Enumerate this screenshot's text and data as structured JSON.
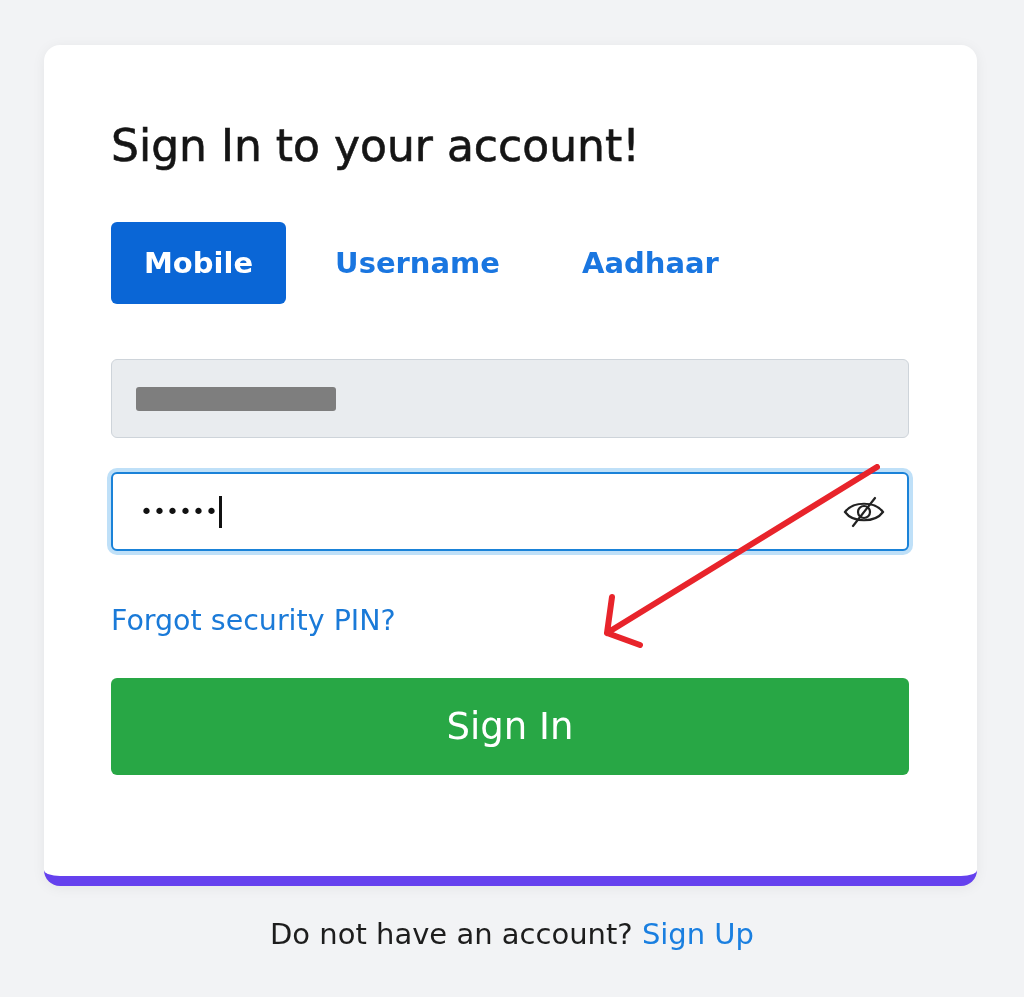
{
  "card": {
    "title": "Sign In to your account!",
    "tabs": [
      {
        "label": "Mobile",
        "selected": true
      },
      {
        "label": "Username",
        "selected": false
      },
      {
        "label": "Aadhaar",
        "selected": false
      }
    ],
    "mobile_field": {
      "disabled": true,
      "redacted": true
    },
    "password_field": {
      "value": "••••••",
      "focused": true
    },
    "forgot_link": "Forgot security PIN?",
    "submit_button": "Sign In"
  },
  "footer": {
    "text": "Do not have an account?",
    "link": "Sign Up"
  }
}
